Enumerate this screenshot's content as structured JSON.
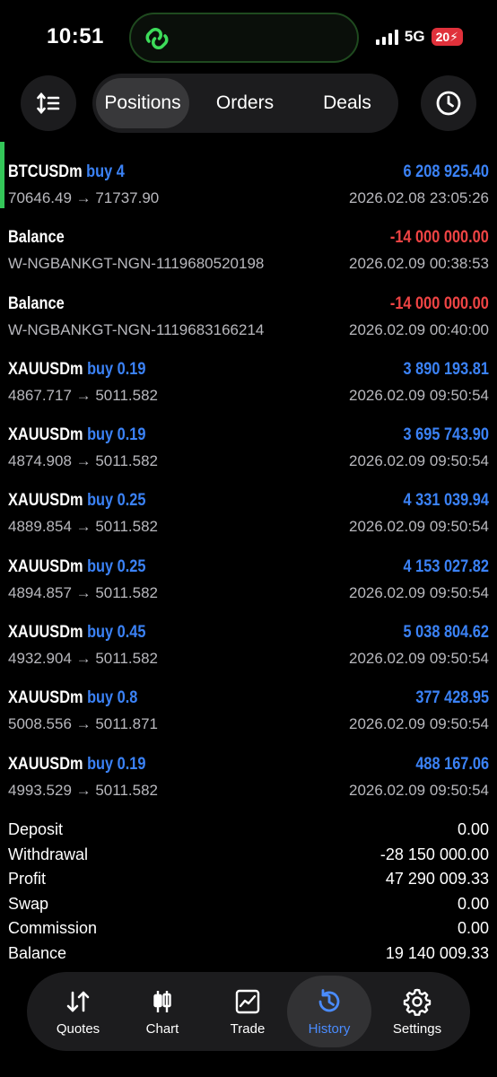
{
  "status_bar": {
    "time": "10:51",
    "network": "5G",
    "battery": "20"
  },
  "toolbar": {
    "sort_icon": "sort-icon",
    "tabs": [
      {
        "label": "Positions",
        "active": true
      },
      {
        "label": "Orders",
        "active": false
      },
      {
        "label": "Deals",
        "active": false
      }
    ],
    "clock_icon": "clock-icon"
  },
  "rows": [
    {
      "symbol": "BTCUSDm",
      "side": "buy 4",
      "amount": "6 208 925.40",
      "sign": "pos",
      "sub": "70646.49 → 71737.90",
      "time": "2026.02.08 23:05:26",
      "highlight": true
    },
    {
      "symbol": "Balance",
      "side": "",
      "amount": "-14 000 000.00",
      "sign": "neg",
      "sub": "W-NGBANKGT-NGN-1119680520198",
      "time": "2026.02.09 00:38:53"
    },
    {
      "symbol": "Balance",
      "side": "",
      "amount": "-14 000 000.00",
      "sign": "neg",
      "sub": "W-NGBANKGT-NGN-1119683166214",
      "time": "2026.02.09 00:40:00"
    },
    {
      "symbol": "XAUUSDm",
      "side": "buy 0.19",
      "amount": "3 890 193.81",
      "sign": "pos",
      "sub": "4867.717 → 5011.582",
      "time": "2026.02.09 09:50:54"
    },
    {
      "symbol": "XAUUSDm",
      "side": "buy 0.19",
      "amount": "3 695 743.90",
      "sign": "pos",
      "sub": "4874.908 → 5011.582",
      "time": "2026.02.09 09:50:54"
    },
    {
      "symbol": "XAUUSDm",
      "side": "buy 0.25",
      "amount": "4 331 039.94",
      "sign": "pos",
      "sub": "4889.854 → 5011.582",
      "time": "2026.02.09 09:50:54"
    },
    {
      "symbol": "XAUUSDm",
      "side": "buy 0.25",
      "amount": "4 153 027.82",
      "sign": "pos",
      "sub": "4894.857 → 5011.582",
      "time": "2026.02.09 09:50:54"
    },
    {
      "symbol": "XAUUSDm",
      "side": "buy 0.45",
      "amount": "5 038 804.62",
      "sign": "pos",
      "sub": "4932.904 → 5011.582",
      "time": "2026.02.09 09:50:54"
    },
    {
      "symbol": "XAUUSDm",
      "side": "buy 0.8",
      "amount": "377 428.95",
      "sign": "pos",
      "sub": "5008.556 → 5011.871",
      "time": "2026.02.09 09:50:54"
    },
    {
      "symbol": "XAUUSDm",
      "side": "buy 0.19",
      "amount": "488 167.06",
      "sign": "pos",
      "sub": "4993.529 → 5011.582",
      "time": "2026.02.09 09:50:54"
    }
  ],
  "summary": [
    {
      "label": "Deposit",
      "value": "0.00"
    },
    {
      "label": "Withdrawal",
      "value": "-28 150 000.00"
    },
    {
      "label": "Profit",
      "value": "47 290 009.33"
    },
    {
      "label": "Swap",
      "value": "0.00"
    },
    {
      "label": "Commission",
      "value": "0.00"
    },
    {
      "label": "Balance",
      "value": "19 140 009.33"
    }
  ],
  "tabbar": [
    {
      "label": "Quotes",
      "icon": "quotes-icon",
      "active": false
    },
    {
      "label": "Chart",
      "icon": "candlestick-icon",
      "active": false
    },
    {
      "label": "Trade",
      "icon": "trade-chart-icon",
      "active": false
    },
    {
      "label": "History",
      "icon": "history-icon",
      "active": true
    },
    {
      "label": "Settings",
      "icon": "gear-icon",
      "active": false
    }
  ],
  "colors": {
    "positive": "#3b82f6",
    "negative": "#ef4444",
    "accent": "#34c759",
    "active_tab": "#4a8cff"
  }
}
